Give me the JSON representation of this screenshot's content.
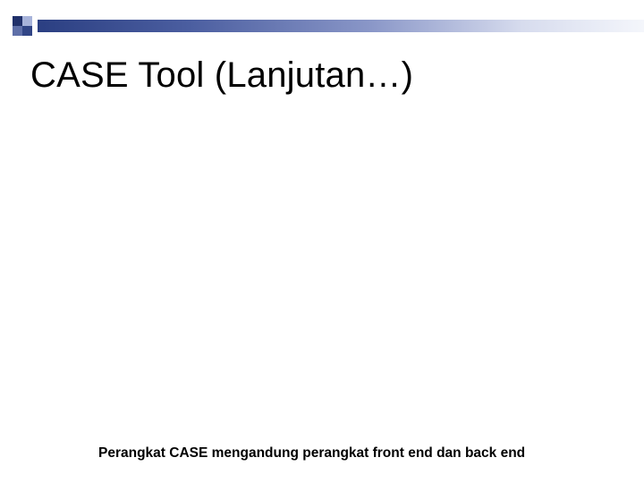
{
  "slide": {
    "title": "CASE Tool (Lanjutan…)",
    "body": "Perangkat CASE mengandung perangkat front end dan back end"
  },
  "theme": {
    "accent_dark": "#2b3f82",
    "accent_light": "#d7dcee"
  }
}
